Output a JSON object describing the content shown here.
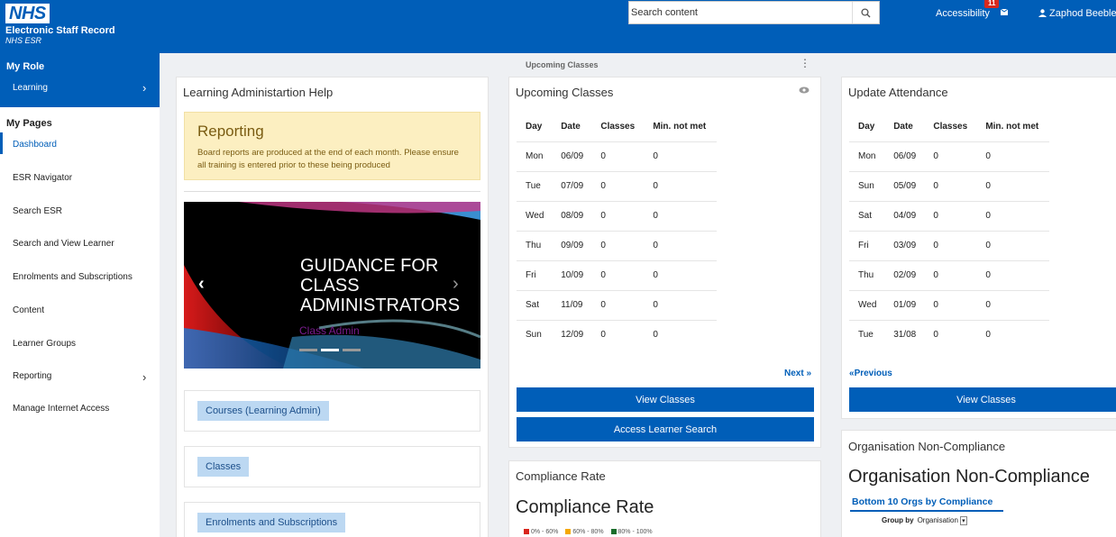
{
  "header": {
    "logo_box": "NHS",
    "logo_line1": "Electronic Staff Record",
    "logo_line2": "NHS ESR",
    "search_placeholder": "Search content",
    "accessibility": "Accessibility",
    "notification_count": "11",
    "user_name": "Zaphod Beeblebrox"
  },
  "sidebar": {
    "role_title": "My Role",
    "role_item": "Learning",
    "pages_title": "My Pages",
    "items": [
      {
        "label": "Dashboard"
      },
      {
        "label": "ESR Navigator"
      },
      {
        "label": "Search ESR"
      },
      {
        "label": "Search and View Learner"
      },
      {
        "label": "Enrolments and Subscriptions"
      },
      {
        "label": "Content"
      },
      {
        "label": "Learner Groups"
      },
      {
        "label": "Reporting"
      },
      {
        "label": "Manage Internet Access"
      }
    ]
  },
  "top_label": "Upcoming Classes",
  "help_panel": {
    "title": "Learning Administartion Help",
    "reporting_title": "Reporting",
    "reporting_text": "Board reports are produced at the end of each month. Please ensure all training is entered prior to these being produced",
    "carousel_text": "GUIDANCE FOR CLASS ADMINISTRATORS",
    "carousel_sub": "Class Admin",
    "links": [
      "Courses (Learning Admin)",
      "Classes",
      "Enrolments and Subscriptions"
    ]
  },
  "upcoming": {
    "title": "Upcoming Classes",
    "headers": [
      "Day",
      "Date",
      "Classes",
      "Min. not met"
    ],
    "rows": [
      [
        "Mon",
        "06/09",
        "0",
        "0"
      ],
      [
        "Tue",
        "07/09",
        "0",
        "0"
      ],
      [
        "Wed",
        "08/09",
        "0",
        "0"
      ],
      [
        "Thu",
        "09/09",
        "0",
        "0"
      ],
      [
        "Fri",
        "10/09",
        "0",
        "0"
      ],
      [
        "Sat",
        "11/09",
        "0",
        "0"
      ],
      [
        "Sun",
        "12/09",
        "0",
        "0"
      ]
    ],
    "next": "Next",
    "view_btn": "View Classes",
    "access_btn": "Access Learner Search"
  },
  "attendance": {
    "title": "Update Attendance",
    "headers": [
      "Day",
      "Date",
      "Classes",
      "Min. not met"
    ],
    "rows": [
      [
        "Mon",
        "06/09",
        "0",
        "0"
      ],
      [
        "Sun",
        "05/09",
        "0",
        "0"
      ],
      [
        "Sat",
        "04/09",
        "0",
        "0"
      ],
      [
        "Fri",
        "03/09",
        "0",
        "0"
      ],
      [
        "Thu",
        "02/09",
        "0",
        "0"
      ],
      [
        "Wed",
        "01/09",
        "0",
        "0"
      ],
      [
        "Tue",
        "31/08",
        "0",
        "0"
      ]
    ],
    "previous": "Previous",
    "view_btn": "View Classes"
  },
  "compliance": {
    "title": "Compliance Rate",
    "heading": "Compliance Rate",
    "legend": [
      {
        "label": "0% - 60%",
        "color": "#d9251c"
      },
      {
        "label": "60% - 80%",
        "color": "#f5a800"
      },
      {
        "label": "80% - 100%",
        "color": "#1b6e2c"
      }
    ]
  },
  "noncompliance": {
    "title": "Organisation Non-Compliance",
    "heading": "Organisation Non-Compliance",
    "link": "Bottom 10 Orgs by Compliance",
    "group_by_label": "Group by",
    "group_by_value": "Organisation"
  },
  "colors": {
    "brand": "#005eb8",
    "alert": "#fcefc1"
  }
}
